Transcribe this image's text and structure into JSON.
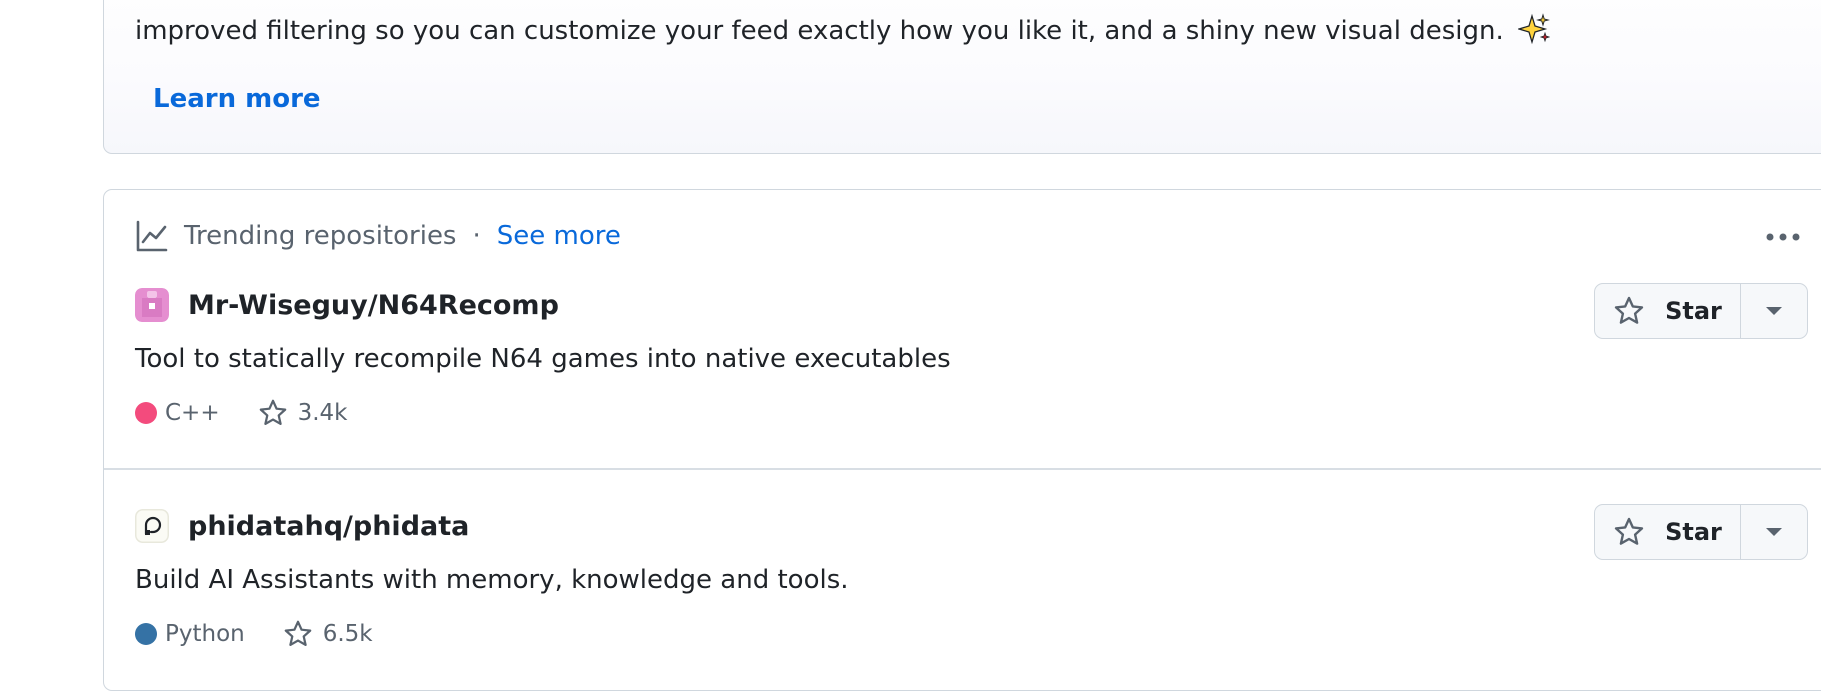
{
  "announcement": {
    "text": "improved filtering so you can customize your feed exactly how you like it, and a shiny new visual design.",
    "icon": "sparkle-icon",
    "learn_more_label": "Learn more"
  },
  "trending": {
    "icon": "graph-icon",
    "title": "Trending repositories",
    "separator": "·",
    "see_more_label": "See more",
    "menu_icon": "kebab-horizontal-icon",
    "repos": [
      {
        "name": "Mr-Wiseguy/N64Recomp",
        "description": "Tool to statically recompile N64 games into native executables",
        "language": "C++",
        "language_color": "#f34b7d",
        "stars": "3.4k",
        "star_label": "Star"
      },
      {
        "name": "phidatahq/phidata",
        "description": "Build AI Assistants with memory, knowledge and tools.",
        "language": "Python",
        "language_color": "#3572A5",
        "stars": "6.5k",
        "star_label": "Star"
      }
    ]
  },
  "colors": {
    "link": "#0969da",
    "muted": "#59636e",
    "border": "#d0d7de"
  }
}
